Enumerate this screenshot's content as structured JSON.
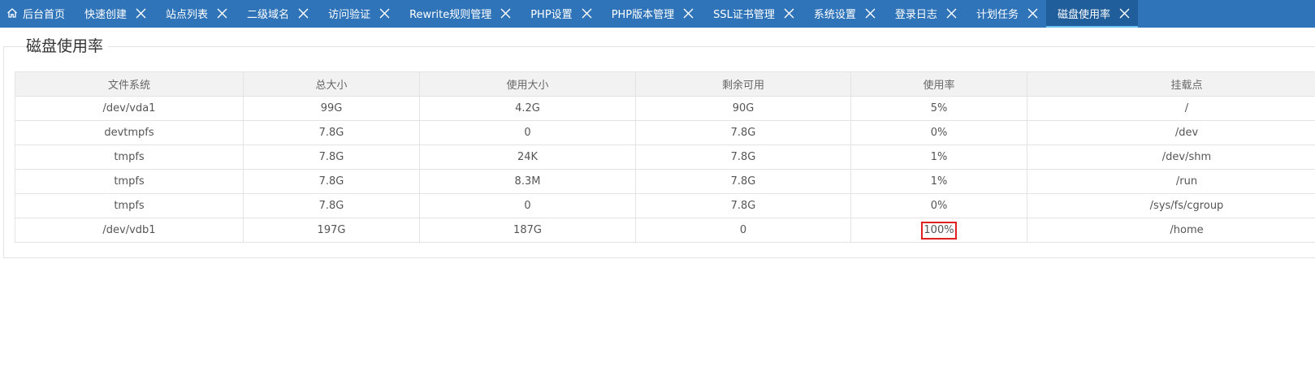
{
  "tabs": [
    {
      "label": "后台首页",
      "home": true,
      "closable": false
    },
    {
      "label": "快速创建",
      "closable": true
    },
    {
      "label": "站点列表",
      "closable": true
    },
    {
      "label": "二级域名",
      "closable": true
    },
    {
      "label": "访问验证",
      "closable": true
    },
    {
      "label": "Rewrite规则管理",
      "closable": true
    },
    {
      "label": "PHP设置",
      "closable": true
    },
    {
      "label": "PHP版本管理",
      "closable": true
    },
    {
      "label": "SSL证书管理",
      "closable": true
    },
    {
      "label": "系统设置",
      "closable": true
    },
    {
      "label": "登录日志",
      "closable": true
    },
    {
      "label": "计划任务",
      "closable": true
    },
    {
      "label": "磁盘使用率",
      "closable": true,
      "active": true
    }
  ],
  "colors": {
    "tabbar": "#2f74b8",
    "active_tab": "#1f5d9b",
    "highlight_border": "#e02020"
  },
  "panel": {
    "title": "磁盘使用率"
  },
  "table": {
    "headers": [
      "文件系统",
      "总大小",
      "使用大小",
      "剩余可用",
      "使用率",
      "挂载点"
    ],
    "rows": [
      [
        "/dev/vda1",
        "99G",
        "4.2G",
        "90G",
        "5%",
        "/"
      ],
      [
        "devtmpfs",
        "7.8G",
        "0",
        "7.8G",
        "0%",
        "/dev"
      ],
      [
        "tmpfs",
        "7.8G",
        "24K",
        "7.8G",
        "1%",
        "/dev/shm"
      ],
      [
        "tmpfs",
        "7.8G",
        "8.3M",
        "7.8G",
        "1%",
        "/run"
      ],
      [
        "tmpfs",
        "7.8G",
        "0",
        "7.8G",
        "0%",
        "/sys/fs/cgroup"
      ],
      [
        "/dev/vdb1",
        "197G",
        "187G",
        "0",
        "100%",
        "/home"
      ]
    ],
    "highlighted_cell": {
      "row": 5,
      "col": 4
    }
  }
}
